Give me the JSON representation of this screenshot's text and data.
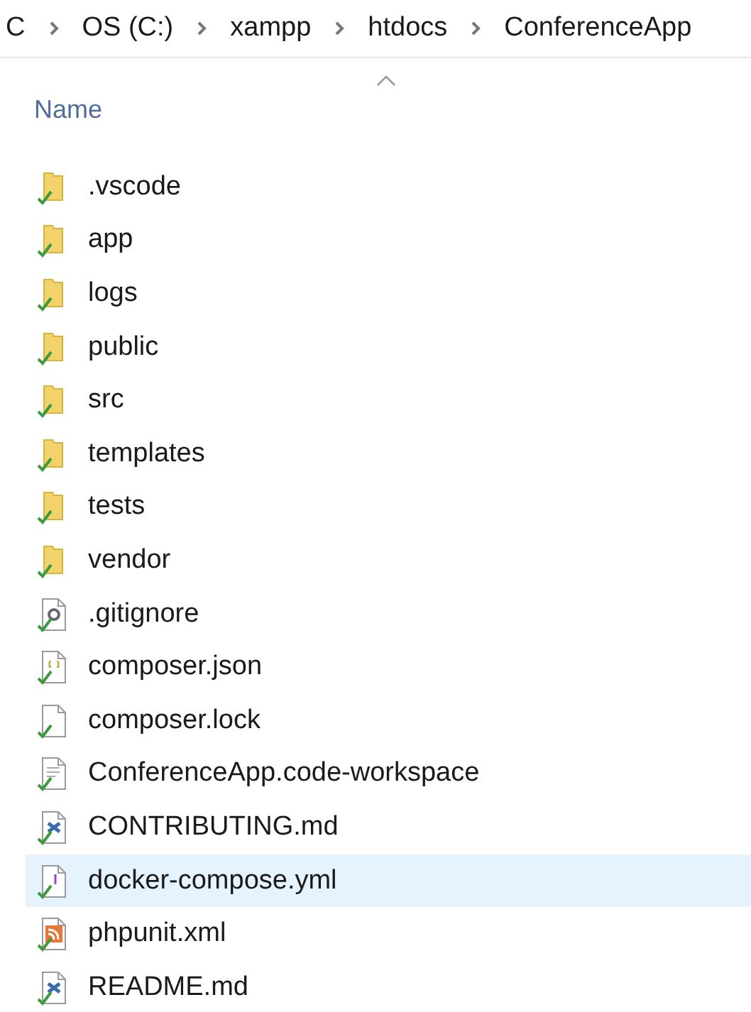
{
  "breadcrumb": [
    "C",
    "OS (C:)",
    "xampp",
    "htdocs",
    "ConferenceApp"
  ],
  "column_header": {
    "label": "Name",
    "sorted": true
  },
  "items": [
    {
      "name": ".vscode",
      "kind": "folder",
      "hovered": false
    },
    {
      "name": "app",
      "kind": "folder",
      "hovered": false
    },
    {
      "name": "logs",
      "kind": "folder",
      "hovered": false
    },
    {
      "name": "public",
      "kind": "folder",
      "hovered": false
    },
    {
      "name": "src",
      "kind": "folder",
      "hovered": false
    },
    {
      "name": "templates",
      "kind": "folder",
      "hovered": false
    },
    {
      "name": "tests",
      "kind": "folder",
      "hovered": false
    },
    {
      "name": "vendor",
      "kind": "folder",
      "hovered": false
    },
    {
      "name": ".gitignore",
      "kind": "config",
      "hovered": false
    },
    {
      "name": "composer.json",
      "kind": "json",
      "hovered": false
    },
    {
      "name": "composer.lock",
      "kind": "blank",
      "hovered": false
    },
    {
      "name": "ConferenceApp.code-workspace",
      "kind": "text",
      "hovered": false
    },
    {
      "name": "CONTRIBUTING.md",
      "kind": "markdown",
      "hovered": false
    },
    {
      "name": "docker-compose.yml",
      "kind": "yaml",
      "hovered": true
    },
    {
      "name": "phpunit.xml",
      "kind": "feed",
      "hovered": false
    },
    {
      "name": "README.md",
      "kind": "markdown",
      "hovered": false
    }
  ]
}
